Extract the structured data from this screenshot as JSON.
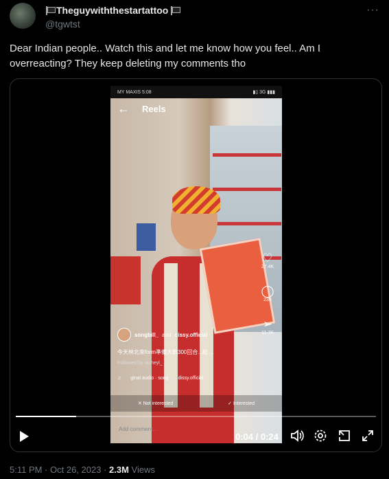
{
  "tweet": {
    "display_name": "Theguywiththestartattoo",
    "handle": "@tgwtst",
    "text": "Dear Indian people.. Watch this and let me know how you feel.. Am I overreacting? They keep deleting my comments tho",
    "more_icon": "more-horizontal-icon"
  },
  "phone": {
    "carrier_time": "MY MAXIS 5:08",
    "status_right": "▮▯ 3G ▮▮▮",
    "screen_title": "Reels",
    "likes": "27.4K",
    "comments": "236",
    "shares": "11.7K",
    "users_label": "songbill_",
    "users_and": "and",
    "users_second": "dissy.official",
    "caption": "今天林北來form準備大戰300回合...結 ...",
    "followed_by": "Followed by racheyl_",
    "audio_1": "ginal audio · song",
    "audio_2": "dissy.official",
    "not_interested": "Not interested",
    "interested": "Interested",
    "add_comment": "Add comment..."
  },
  "player": {
    "progress": 0.167,
    "time": "0:04 / 0:24"
  },
  "footer": {
    "time": "5:11 PM · Oct 26, 2023 · ",
    "views_count": "2.3M",
    "views_label": " Views"
  }
}
